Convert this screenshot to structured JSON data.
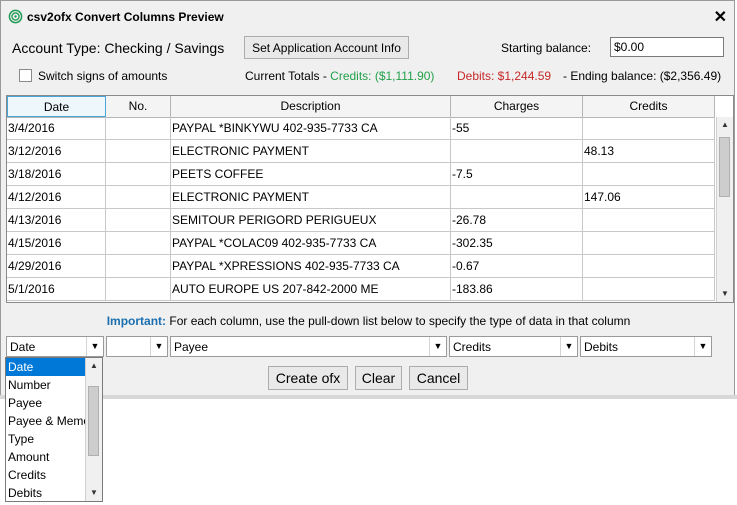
{
  "window": {
    "title": "csv2ofx Convert Columns Preview",
    "close_glyph": "✕"
  },
  "header": {
    "account_type": "Account Type: Checking / Savings",
    "set_account_button": "Set Application Account Info",
    "starting_balance_label": "Starting balance:",
    "starting_balance_value": "$0.00",
    "switch_signs_label": "Switch signs of amounts",
    "totals_label": "Current Totals - ",
    "credits_total": "Credits: ($1,111.90)",
    "debits_total": "Debits: $1,244.59",
    "ending_balance": "- Ending balance: ($2,356.49)"
  },
  "table": {
    "columns": [
      "Date",
      "No.",
      "Description",
      "Charges",
      "Credits"
    ],
    "rows": [
      [
        "3/4/2016",
        "",
        "PAYPAL *BINKYWU 402-935-7733 CA",
        "-55",
        ""
      ],
      [
        "3/12/2016",
        "",
        "ELECTRONIC PAYMENT",
        "",
        "48.13"
      ],
      [
        "3/18/2016",
        "",
        "PEETS COFFEE",
        "-7.5",
        ""
      ],
      [
        "4/12/2016",
        "",
        "ELECTRONIC PAYMENT",
        "",
        "147.06"
      ],
      [
        "4/13/2016",
        "",
        "SEMITOUR PERIGORD PERIGUEUX",
        "-26.78",
        ""
      ],
      [
        "4/15/2016",
        "",
        "PAYPAL *COLAC09 402-935-7733 CA",
        "-302.35",
        ""
      ],
      [
        "4/29/2016",
        "",
        "PAYPAL *XPRESSIONS 402-935-7733 CA",
        "-0.67",
        ""
      ],
      [
        "5/1/2016",
        "",
        "AUTO EUROPE US 207-842-2000 ME",
        "-183.86",
        ""
      ]
    ]
  },
  "important": {
    "label": "Important:",
    "text": " For each column, use the pull-down list below to specify the type of data in that column"
  },
  "column_types": [
    "Date",
    "",
    "Payee",
    "Credits",
    "Debits"
  ],
  "dropdown": {
    "options": [
      "Date",
      "Number",
      "Payee",
      "Payee & Memo",
      "Type",
      "Amount",
      "Credits",
      "Debits"
    ],
    "selected": "Date"
  },
  "buttons": {
    "create": "Create ofx",
    "clear": "Clear",
    "cancel": "Cancel"
  },
  "icons": {
    "app": "fingerprint-icon",
    "scroll_up": "▲",
    "scroll_down": "▼",
    "combo_arrow": "▼"
  }
}
